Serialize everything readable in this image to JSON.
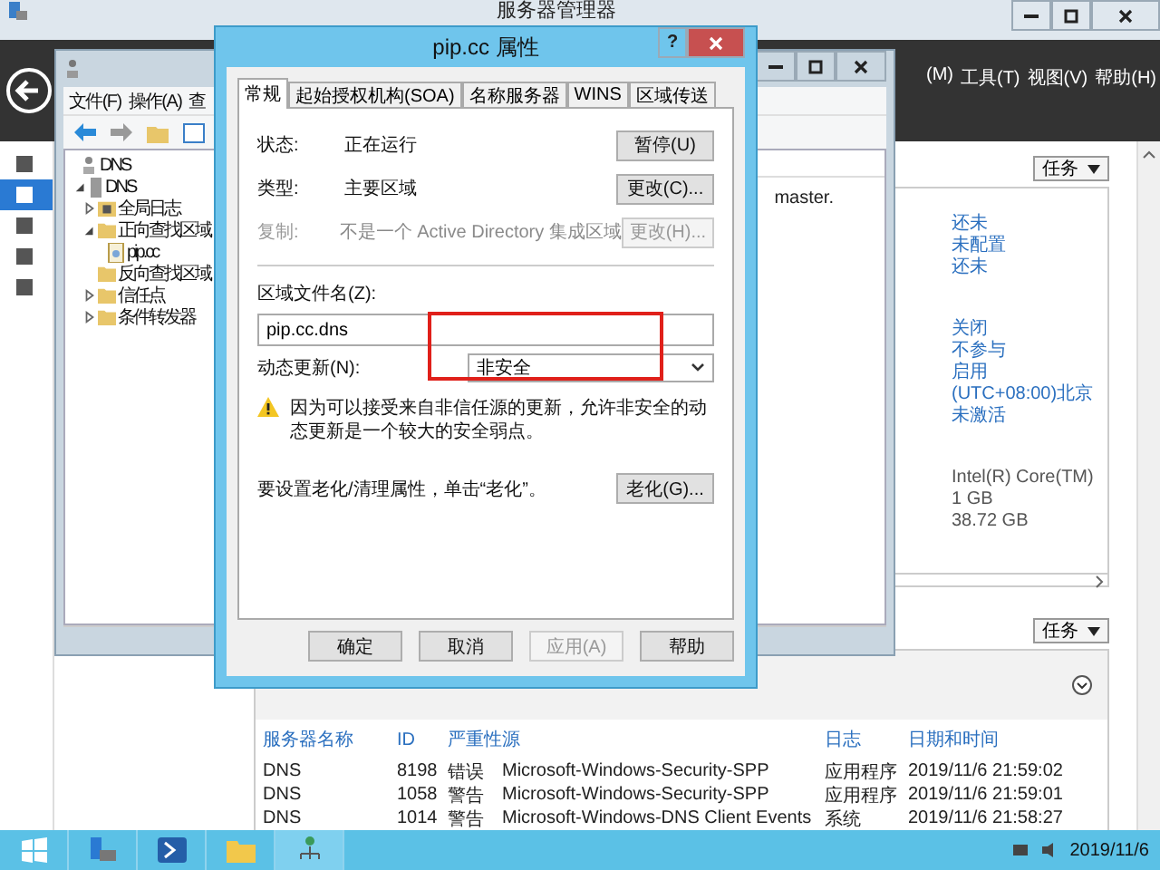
{
  "server_manager": {
    "title": "服务器管理器",
    "menu": [
      "(M)",
      "工具(T)",
      "视图(V)",
      "帮助(H)"
    ],
    "sidebar": [
      {
        "selected": false
      },
      {
        "selected": true
      },
      {
        "selected": false
      },
      {
        "selected": false
      },
      {
        "selected": false
      }
    ],
    "properties": {
      "task_button": "任务",
      "groups": [
        [
          "还未",
          "未配置",
          "还未"
        ],
        [
          "关闭",
          "不参与",
          "启用",
          "(UTC+08:00)北京",
          "未激活"
        ]
      ],
      "hardware": [
        "Intel(R) Core(TM)",
        "1 GB",
        "38.72 GB"
      ]
    },
    "events": {
      "task_button": "任务",
      "columns": [
        "服务器名称",
        "ID",
        "严重性",
        "源",
        "日志",
        "日期和时间"
      ],
      "rows": [
        [
          "DNS",
          "8198",
          "错误",
          "Microsoft-Windows-Security-SPP",
          "应用程序",
          "2019/11/6 21:59:02"
        ],
        [
          "DNS",
          "1058",
          "警告",
          "Microsoft-Windows-Security-SPP",
          "应用程序",
          "2019/11/6 21:59:01"
        ],
        [
          "DNS",
          "1014",
          "警告",
          "Microsoft-Windows-DNS Client Events",
          "系统",
          "2019/11/6 21:58:27"
        ]
      ]
    }
  },
  "dns_window": {
    "menu": [
      "文件(F)",
      "操作(A)",
      "查"
    ],
    "detail_text": "master.",
    "tree": [
      {
        "label": "DNS",
        "kind": "root",
        "children": [
          {
            "label": "DNS",
            "kind": "server",
            "expanded": true,
            "children": [
              {
                "label": "全局日志",
                "kind": "log",
                "expanded": false
              },
              {
                "label": "正向查找区域",
                "kind": "folder",
                "expanded": true,
                "children": [
                  {
                    "label": "pip.cc",
                    "kind": "zone"
                  }
                ]
              },
              {
                "label": "反向查找区域",
                "kind": "folder"
              },
              {
                "label": "信任点",
                "kind": "folder",
                "expanded": false
              },
              {
                "label": "条件转发器",
                "kind": "folder",
                "expanded": false
              }
            ]
          }
        ]
      }
    ]
  },
  "dialog": {
    "title": "pip.cc 属性",
    "help_button": "?",
    "tabs": [
      {
        "label": "常规",
        "selected": true
      },
      {
        "label": "起始授权机构(SOA)",
        "selected": false
      },
      {
        "label": "名称服务器",
        "selected": false
      },
      {
        "label": "WINS",
        "selected": false
      },
      {
        "label": "区域传送",
        "selected": false
      }
    ],
    "info_rows": [
      {
        "label": "状态:",
        "value": "正在运行",
        "button": "暂停(U)",
        "disabled": false
      },
      {
        "label": "类型:",
        "value": "主要区域",
        "button": "更改(C)...",
        "disabled": false
      },
      {
        "label": "复制:",
        "value": "不是一个 Active Directory 集成区域",
        "button": "更改(H)...",
        "disabled": true
      }
    ],
    "file_label": "区域文件名(Z):",
    "file_value": "pip.cc.dns",
    "dynamic_label": "动态更新(N):",
    "dynamic_value": "非安全",
    "warning": "因为可以接受来自非信任源的更新，允许非安全的动态更新是一个较大的安全弱点。",
    "aging_text": "要设置老化/清理属性，单击“老化”。",
    "aging_button": "老化(G)...",
    "buttons": [
      {
        "label": "确定",
        "disabled": false
      },
      {
        "label": "取消",
        "disabled": false
      },
      {
        "label": "应用(A)",
        "disabled": true
      },
      {
        "label": "帮助",
        "disabled": false
      }
    ]
  },
  "taskbar": {
    "date": "2019/11/6"
  }
}
